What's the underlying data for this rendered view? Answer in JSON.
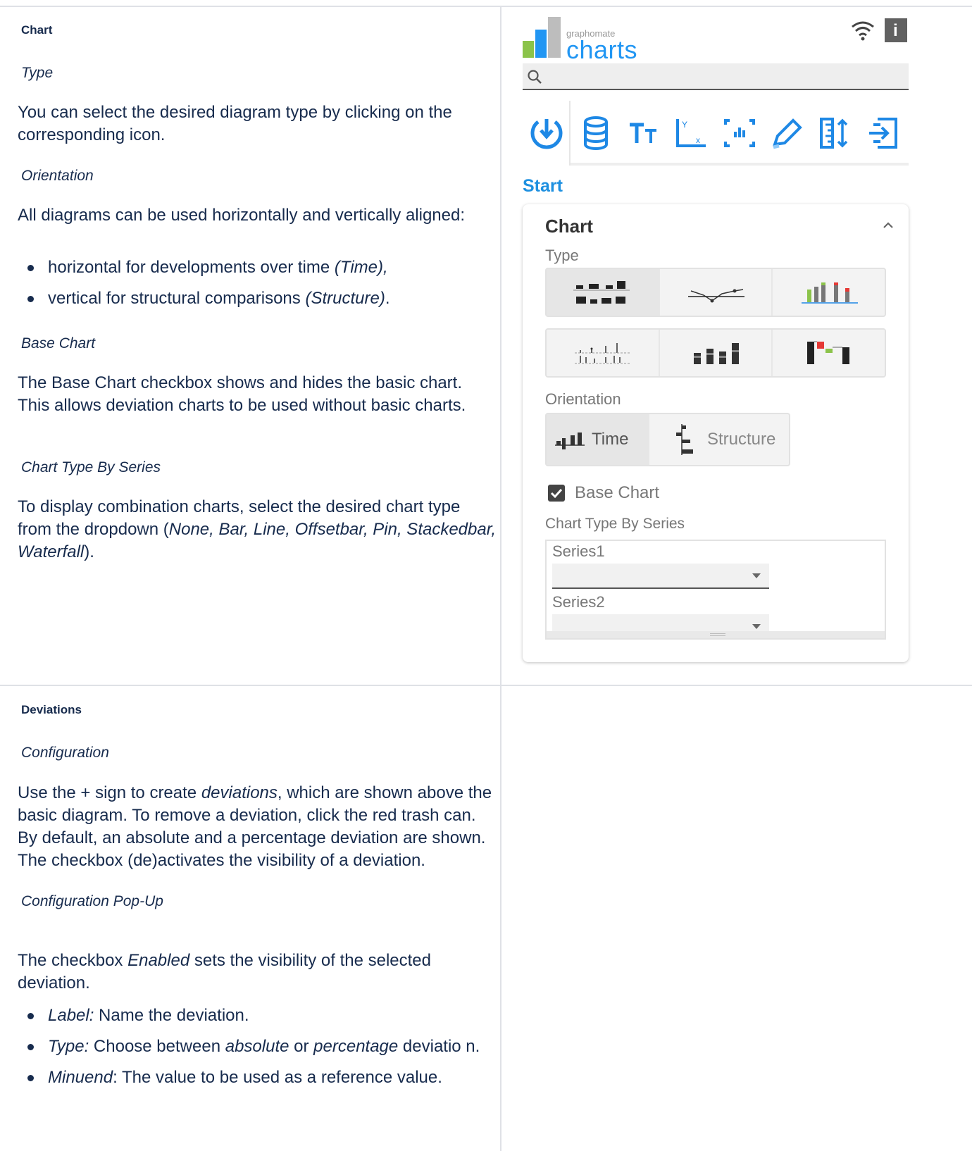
{
  "doc": {
    "chart_section": {
      "heading": "Chart",
      "type_sub": "Type",
      "type_text": "You can select the desired diagram type by clicking on the corresponding icon.",
      "orientation_sub": "Orientation",
      "orientation_text": "All diagrams can be used horizontally and vertically aligned:",
      "bullets": [
        {
          "text": "horizontal for developments over time ",
          "italic": "(Time),",
          "tail": ""
        },
        {
          "text": "vertical for structural comparisons ",
          "italic": "(Structure)",
          "tail": "."
        }
      ],
      "base_chart_sub": "Base Chart",
      "base_chart_text": "The Base Chart checkbox shows and hides the basic chart. This allows deviation charts to be used without basic charts.",
      "chart_type_by_series_sub": "Chart Type By Series",
      "ctbs_text_a": "To display combination charts, select the desired chart type from the dropdown (",
      "ctbs_text_italic": "None, Bar, Line, Offsetbar, Pin, Stackedbar, Waterfall",
      "ctbs_text_b": ")."
    },
    "deviations_section": {
      "heading": "Deviations",
      "config_sub": "Configuration",
      "config_a": "Use the + sign to create ",
      "config_italic": "deviations",
      "config_b": ", which are shown above the basic diagram. To remove a deviation, click the red trash can. By default, an absolute and a percentage deviation are shown. The checkbox (de)activates the visibility of a deviation.",
      "popup_sub": "Configuration Pop-Up",
      "popup_a": "The checkbox ",
      "popup_italic": "Enabled",
      "popup_b": " sets the visibility of the selected deviation.",
      "bullets": [
        {
          "lead": "Label:",
          "text": " Name the deviation.",
          "extra_italic1": "",
          "mid": "",
          "extra_italic2": "",
          "tail": ""
        },
        {
          "lead": "Type:",
          "text": " Choose between ",
          "extra_italic1": "absolute",
          "mid": " or ",
          "extra_italic2": "percentage",
          "tail": " deviatio n."
        },
        {
          "lead": "Minuend",
          "text": ": The value to be used as a reference value.",
          "extra_italic1": "",
          "mid": "",
          "extra_italic2": "",
          "tail": ""
        }
      ]
    }
  },
  "panel": {
    "logo_small": "graphomate",
    "logo_big": "charts",
    "search_placeholder": "",
    "tabs": [
      "start-icon",
      "database-icon",
      "text-size-icon",
      "axis-icon",
      "elements-icon",
      "pen-icon",
      "ruler-icon",
      "export-icon"
    ],
    "section_label": "Start",
    "card": {
      "title": "Chart",
      "type_label": "Type",
      "orientation_label": "Orientation",
      "orientation_time": "Time",
      "orientation_structure": "Structure",
      "base_chart_label": "Base Chart",
      "base_chart_checked": true,
      "chart_type_by_series_label": "Chart Type By Series",
      "series": [
        {
          "name": "Series1",
          "value": ""
        },
        {
          "name": "Series2",
          "value": ""
        }
      ]
    },
    "colors": {
      "accent": "#2196f3",
      "start_label": "#1e90e0",
      "logo_green": "#8bc34a",
      "logo_blue": "#2196f3"
    }
  }
}
